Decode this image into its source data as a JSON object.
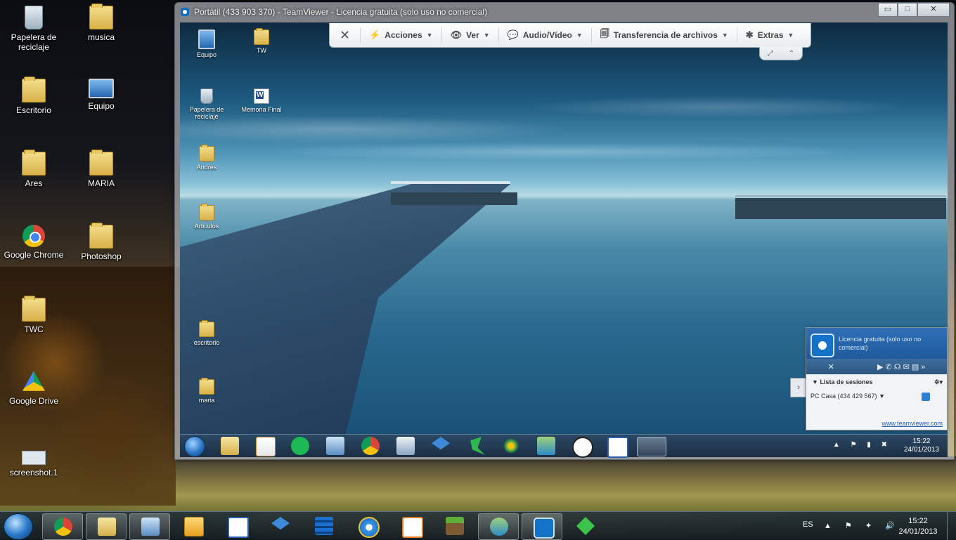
{
  "desktop": {
    "icons": [
      {
        "label": "Papelera de reciclaje",
        "icon": "recycle-bin-icon"
      },
      {
        "label": "musica",
        "icon": "folder-icon"
      },
      {
        "label": "Escritorio",
        "icon": "folder-icon"
      },
      {
        "label": "Equipo",
        "icon": "computer-icon"
      },
      {
        "label": "Ares",
        "icon": "folder-icon"
      },
      {
        "label": "MARIA",
        "icon": "folder-icon"
      },
      {
        "label": "Google Chrome",
        "icon": "chrome-icon"
      },
      {
        "label": "Photoshop",
        "icon": "folder-icon"
      },
      {
        "label": "TWC",
        "icon": "folder-icon"
      },
      {
        "label": "Google Drive",
        "icon": "google-drive-icon"
      },
      {
        "label": "screenshot.1",
        "icon": "image-file-icon"
      }
    ]
  },
  "teamviewer": {
    "title": "Portátil (433 903 370) - TeamViewer - Licencia gratuita (solo uso no comercial)",
    "window_buttons": {
      "minimize": "▭",
      "maximize": "□",
      "close": "✕"
    },
    "toolbar": {
      "close": "✕",
      "items": [
        {
          "label": "Acciones",
          "icon": "lightning-icon",
          "glyph": "⚡"
        },
        {
          "label": "Ver",
          "icon": "eye-icon",
          "glyph": "👁"
        },
        {
          "label": "Audio/Vídeo",
          "icon": "chat-icon",
          "glyph": "💬"
        },
        {
          "label": "Transferencia de archivos",
          "icon": "files-icon",
          "glyph": "🗐"
        },
        {
          "label": "Extras",
          "icon": "puzzle-icon",
          "glyph": "✱"
        }
      ],
      "caret": "▼",
      "tab_fullscreen": "⤢",
      "tab_collapse": "⌃"
    },
    "remote": {
      "icons": [
        {
          "label": "Equipo"
        },
        {
          "label": "TW"
        },
        {
          "label": "Papelera de reciclaje"
        },
        {
          "label": "Memoria Final"
        },
        {
          "label": "Andres"
        },
        {
          "label": "Articulos"
        },
        {
          "label": "escritorio"
        },
        {
          "label": "maria"
        }
      ],
      "clock_time": "15:22",
      "clock_date": "24/01/2013"
    },
    "panel": {
      "license": "Licencia gratuita (solo uso no comercial)",
      "sessions_title": "Lista de sesiones",
      "session": "PC Casa (434 429 567)",
      "link": "www.teamviewer.com",
      "close": "✕",
      "tool_glyphs": "▶ ✆ ☊ ✉ ▤ »",
      "side": "›",
      "gear": "✲▾",
      "caret": "▼"
    }
  },
  "taskbar": {
    "language": "ES",
    "tray_glyphs": "▲ ⚑ ✦ 🔊",
    "time": "15:22",
    "date": "24/01/2013"
  },
  "colors": {
    "teamviewer_blue": "#1473c8",
    "taskbar": "#1b2e44"
  }
}
